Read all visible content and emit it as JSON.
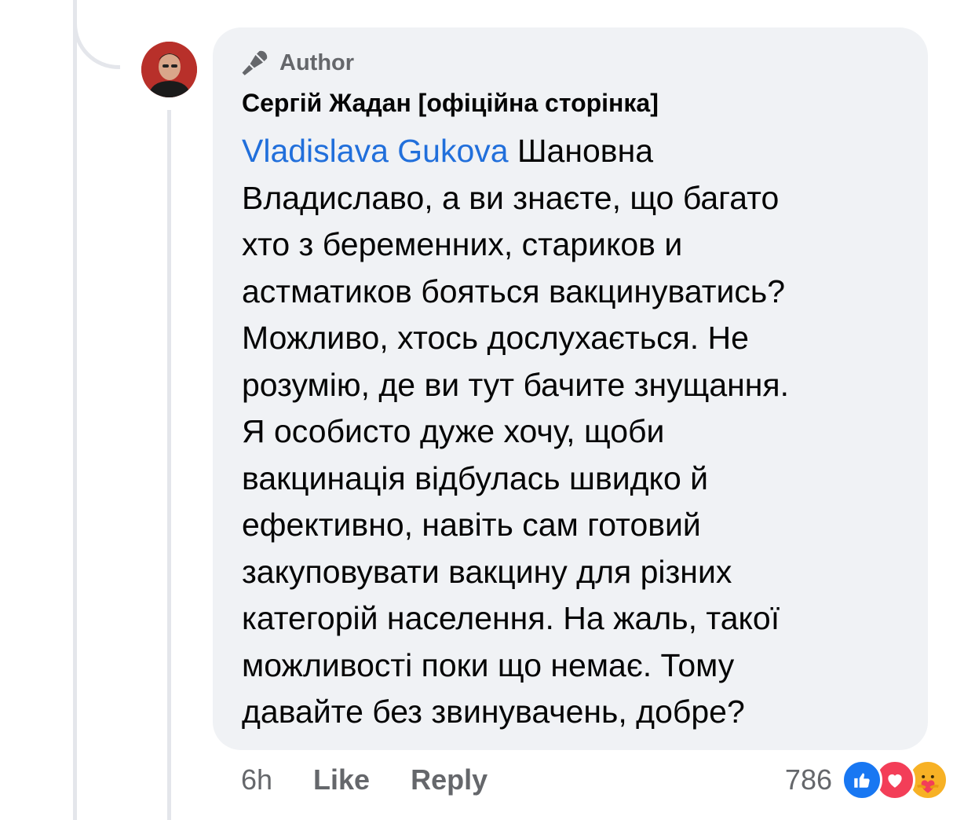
{
  "comment": {
    "badge": "Author",
    "author_name": "Сергій Жадан [офіційна сторінка]",
    "mention": "Vladislava Gukova",
    "text_lines": [
      "Шановна",
      "Владиславо, а ви знаєте, що багато",
      "хто з беременних, стариков и",
      "астматиков бояться вакцинуватись?",
      "Можливо, хтось дослухається. Не",
      "розумію, де ви тут бачите знущання.",
      "Я особисто дуже хочу, щоби",
      "вакцинація відбулась швидко й",
      "ефективно, навіть сам готовий",
      "закуповувати вакцину для різних",
      "категорій населення. На жаль, такої",
      "можливості поки що немає. Тому",
      "давайте без звинувачень, добре?"
    ],
    "time": "6h",
    "like_label": "Like",
    "reply_label": "Reply",
    "reaction_count": "786",
    "reactions": [
      "like-icon",
      "love-icon",
      "care-icon"
    ]
  },
  "colors": {
    "bubble": "#f0f2f5",
    "mention": "#216fdb",
    "secondary_text": "#65676b",
    "like_blue": "#1877f2",
    "love_red": "#f33e58",
    "care_yellow": "#f7b125"
  }
}
